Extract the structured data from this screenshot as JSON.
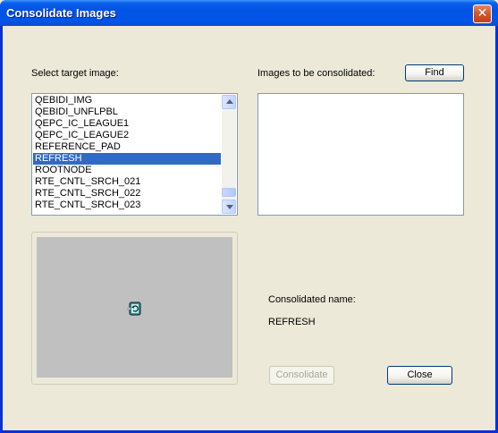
{
  "window": {
    "title": "Consolidate Images",
    "close_glyph": "✕"
  },
  "target": {
    "label": "Select target image:",
    "items": [
      "QEBIDI_IMG",
      "QEBIDI_UNFLPBL",
      "QEPC_IC_LEAGUE1",
      "QEPC_IC_LEAGUE2",
      "REFERENCE_PAD",
      "REFRESH",
      "ROOTNODE",
      "RTE_CNTL_SRCH_021",
      "RTE_CNTL_SRCH_022",
      "RTE_CNTL_SRCH_023"
    ],
    "selected": "REFRESH"
  },
  "consolidate": {
    "label": "Images to be consolidated:",
    "find_label": "Find",
    "items": []
  },
  "preview": {
    "icon": "refresh-icon"
  },
  "result": {
    "name_label": "Consolidated name:",
    "name_value": "REFRESH"
  },
  "buttons": {
    "consolidate_label": "Consolidate",
    "close_label": "Close"
  },
  "colors": {
    "titlebar": "#0055ea",
    "selection": "#316ac5",
    "dialog_bg": "#ece9d8"
  }
}
